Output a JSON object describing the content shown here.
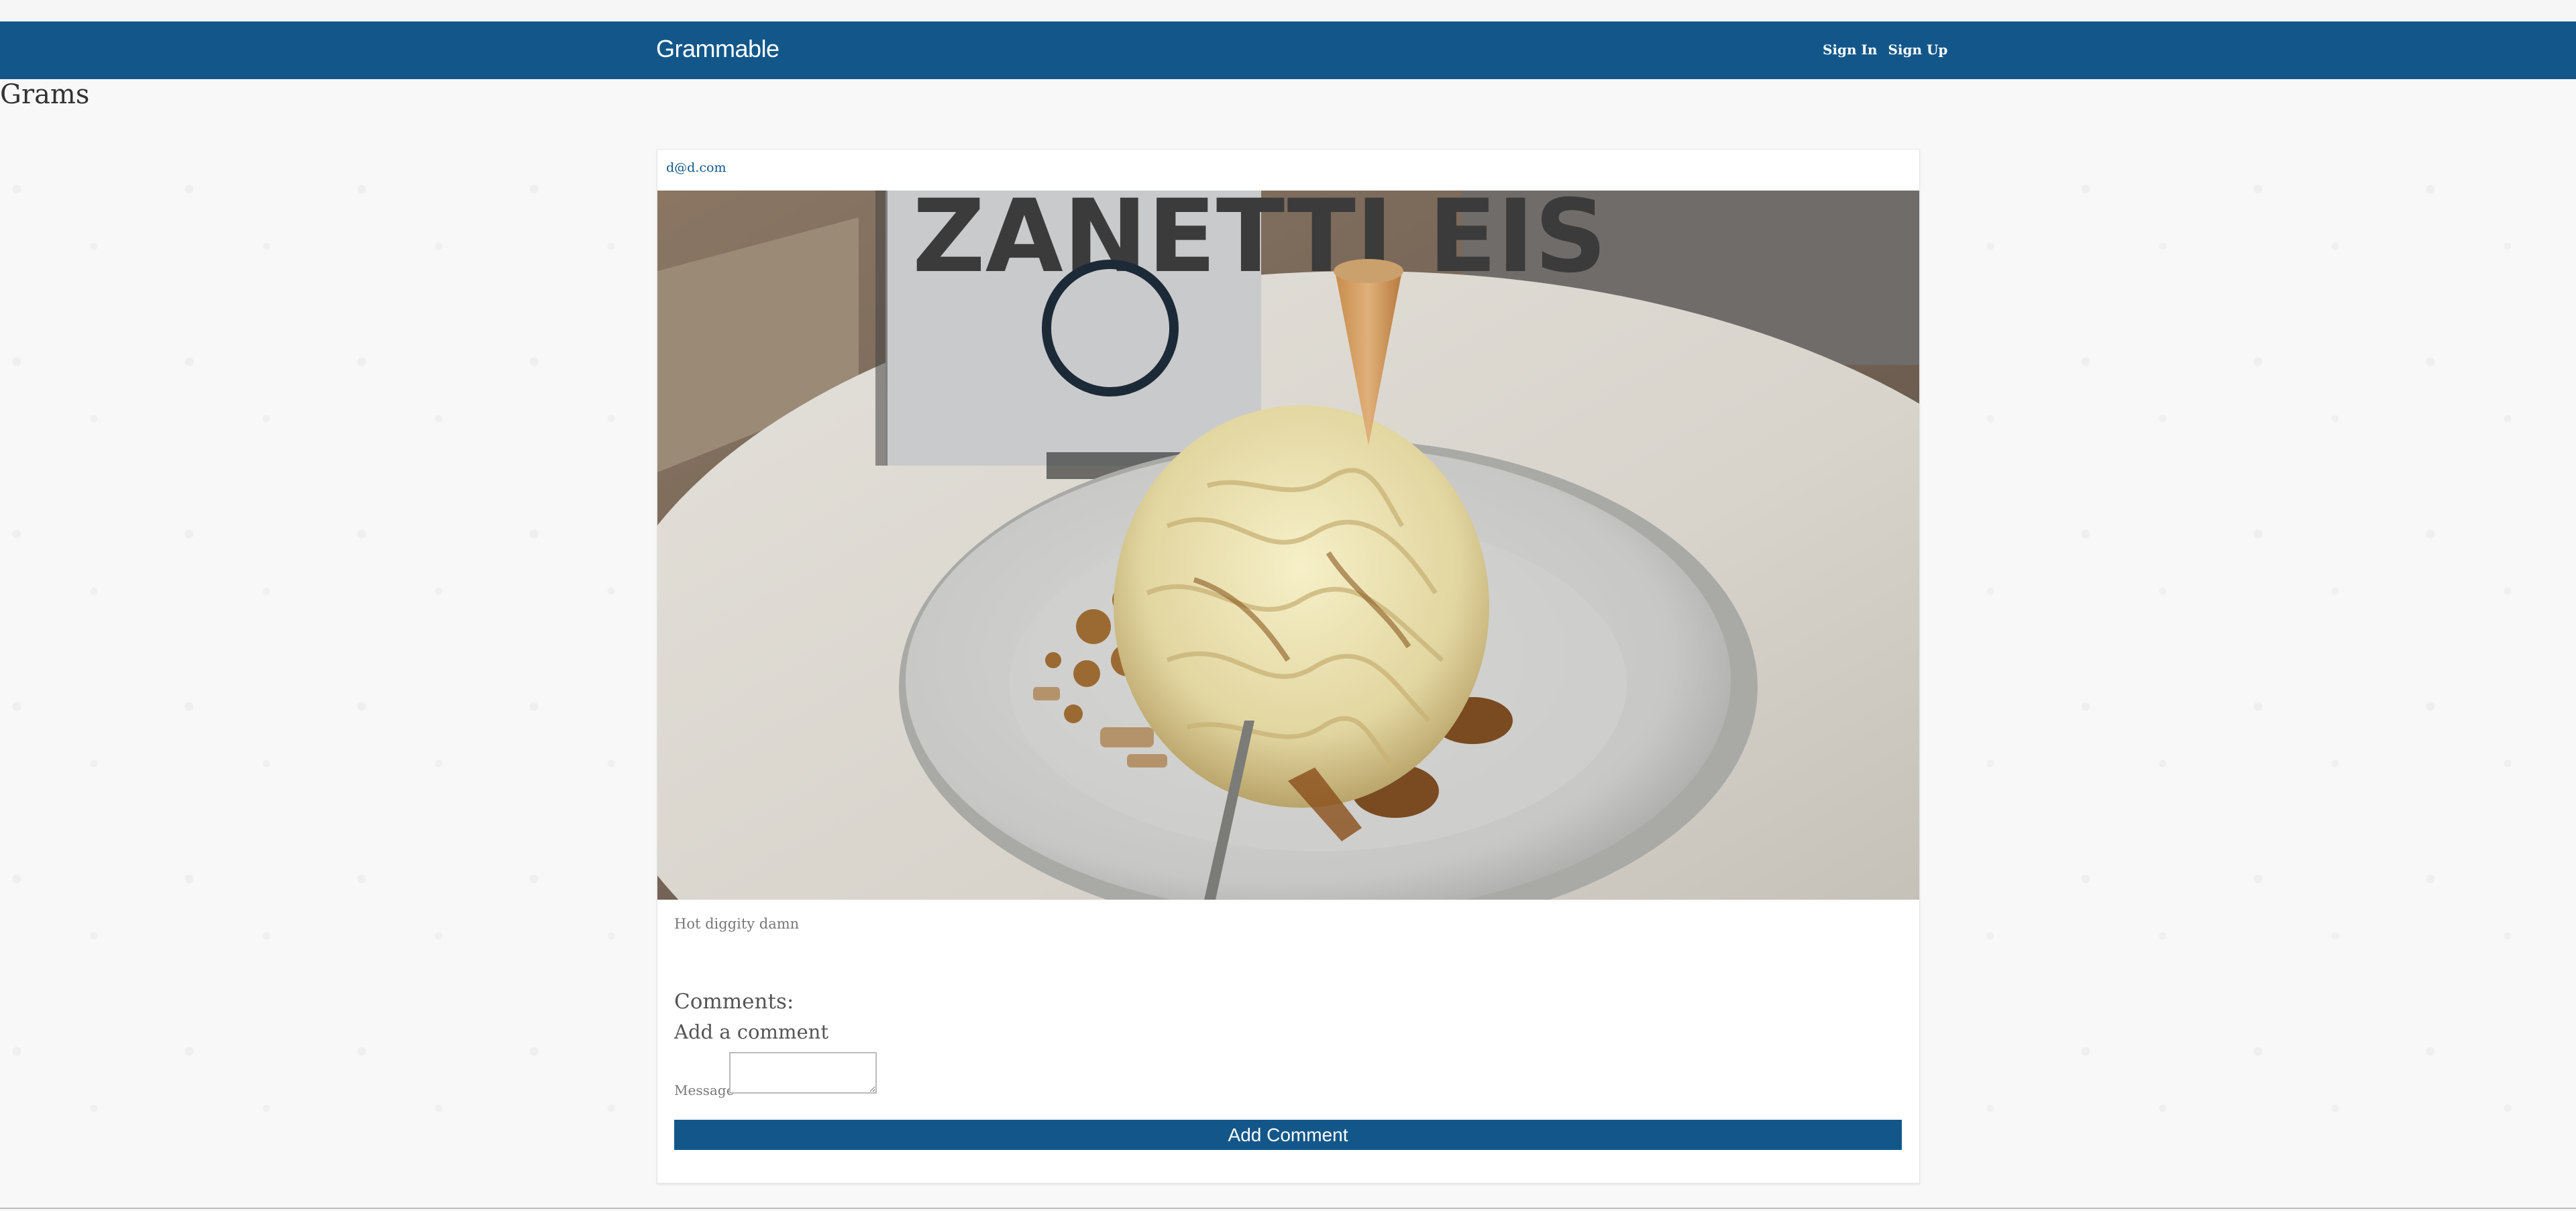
{
  "navbar": {
    "brand": "Grammable",
    "sign_in": "Sign In",
    "sign_up": "Sign Up"
  },
  "page": {
    "title": "Grams"
  },
  "gram": {
    "author": "d@d.com",
    "photo_alt": "Spaghettieis dessert with ice cream noodles, nuts and a waffle cone on a white plate",
    "sign_text": "ZANETTI EIS",
    "caption": "Hot diggity damn",
    "comments_heading": "Comments:",
    "add_comment_heading": "Add a comment",
    "message_label": "Message",
    "message_value": "",
    "add_comment_button": "Add Comment"
  },
  "colors": {
    "primary": "#13578a",
    "background": "#f8f8f8"
  }
}
